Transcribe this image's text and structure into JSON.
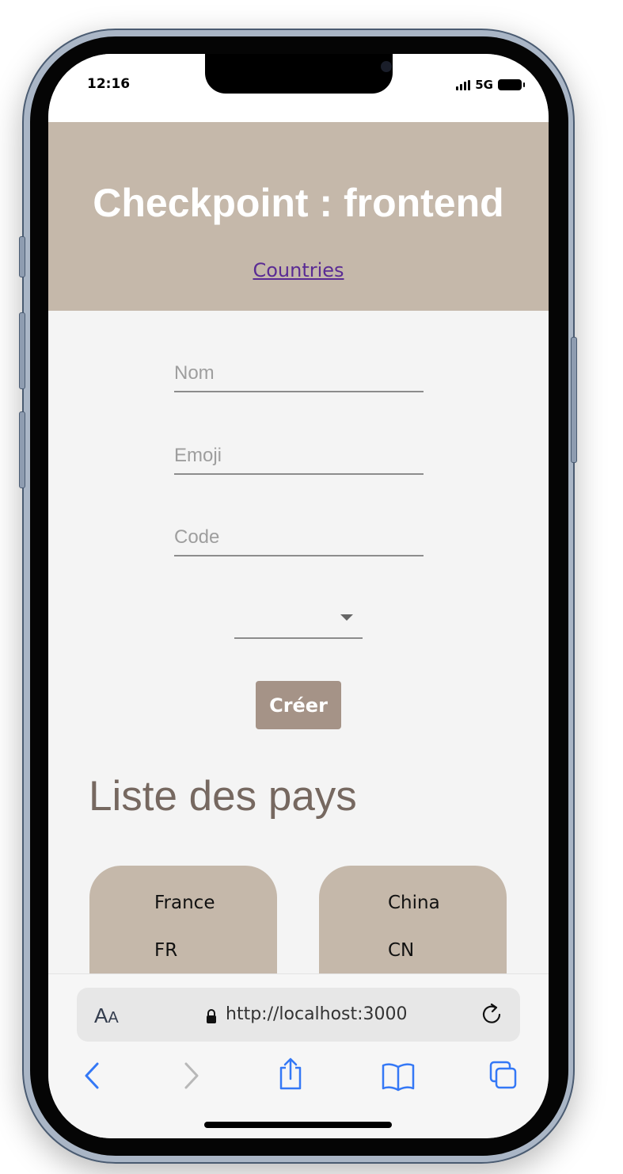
{
  "status_bar": {
    "time": "12:16",
    "network": "5G"
  },
  "header": {
    "title": "Checkpoint : frontend",
    "nav_link": "Countries"
  },
  "form": {
    "nom_placeholder": "Nom",
    "emoji_placeholder": "Emoji",
    "code_placeholder": "Code",
    "select_value": "",
    "submit_label": "Créer"
  },
  "list": {
    "title": "Liste des pays",
    "countries": [
      {
        "name": "France",
        "code": "FR"
      },
      {
        "name": "China",
        "code": "CN"
      }
    ]
  },
  "browser": {
    "text_size_big": "A",
    "text_size_small": "A",
    "url": "http://localhost:3000"
  },
  "colors": {
    "header_bg": "#c5b8aa",
    "button_bg": "#a59387",
    "section_title": "#766860",
    "link": "#5a2b94",
    "ios_blue": "#3478f6"
  }
}
